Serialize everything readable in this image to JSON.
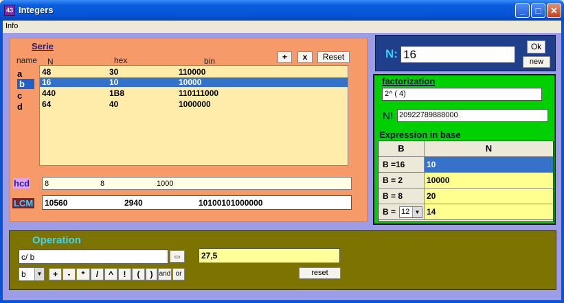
{
  "window": {
    "title": "Integers",
    "app_icon": "integers-app-icon",
    "app_icon_text": "43",
    "minimize": "_",
    "maximize": "□",
    "close": "✕"
  },
  "menu": {
    "items": [
      "Info"
    ]
  },
  "serie": {
    "title": "Serie",
    "name_header": "name",
    "col_n": "N",
    "col_hex": "hex",
    "col_bin": "bin",
    "add_label": "+",
    "remove_label": "x",
    "reset_label": "Reset",
    "names": [
      "a",
      "b",
      "c",
      "d"
    ],
    "selected_index": 1,
    "rows": [
      {
        "n": "48",
        "hex": "30",
        "bin": "110000"
      },
      {
        "n": "16",
        "hex": "10",
        "bin": "10000"
      },
      {
        "n": "440",
        "hex": "1B8",
        "bin": "110111000"
      },
      {
        "n": "64",
        "hex": "40",
        "bin": "1000000"
      }
    ],
    "hcd_label": "hcd",
    "hcd": {
      "n": "8",
      "hex": "8",
      "bin": "1000"
    },
    "lcm_label": "LCM",
    "lcm": {
      "n": "10560",
      "hex": "2940",
      "bin": "10100101000000"
    }
  },
  "n_panel": {
    "label": "N:",
    "value": "16",
    "ok_label": "Ok",
    "new_label": "new"
  },
  "factorization": {
    "title": "factorization",
    "value": "2^ ( 4)",
    "factorial_label": "N!",
    "factorial_value": "20922789888000",
    "expr_title": "Expression in base",
    "col_b": "B",
    "col_n": "N",
    "rows": [
      {
        "base": "B =16",
        "value": "10",
        "selected": true
      },
      {
        "base": "B = 2",
        "value": "10000"
      },
      {
        "base": "B = 8",
        "value": "20"
      },
      {
        "base": "B =",
        "value": "14",
        "select_value": "12"
      }
    ]
  },
  "operation": {
    "title": "Operation",
    "expression": "c/ b",
    "result": "27,5",
    "variable": "b",
    "buttons": [
      "+",
      "-",
      "*",
      "/",
      "^",
      "!",
      "(",
      ")",
      "and",
      "or"
    ],
    "reset_label": "reset"
  },
  "colors": {
    "serie_bg": "#F79A6A",
    "list_bg": "#FFEBAA",
    "selection": "#3473C9",
    "n_panel_bg": "#1F3F8A",
    "fact_bg": "#00D000",
    "op_bg": "#7C7300",
    "client_bg": "#9C9CE8"
  }
}
